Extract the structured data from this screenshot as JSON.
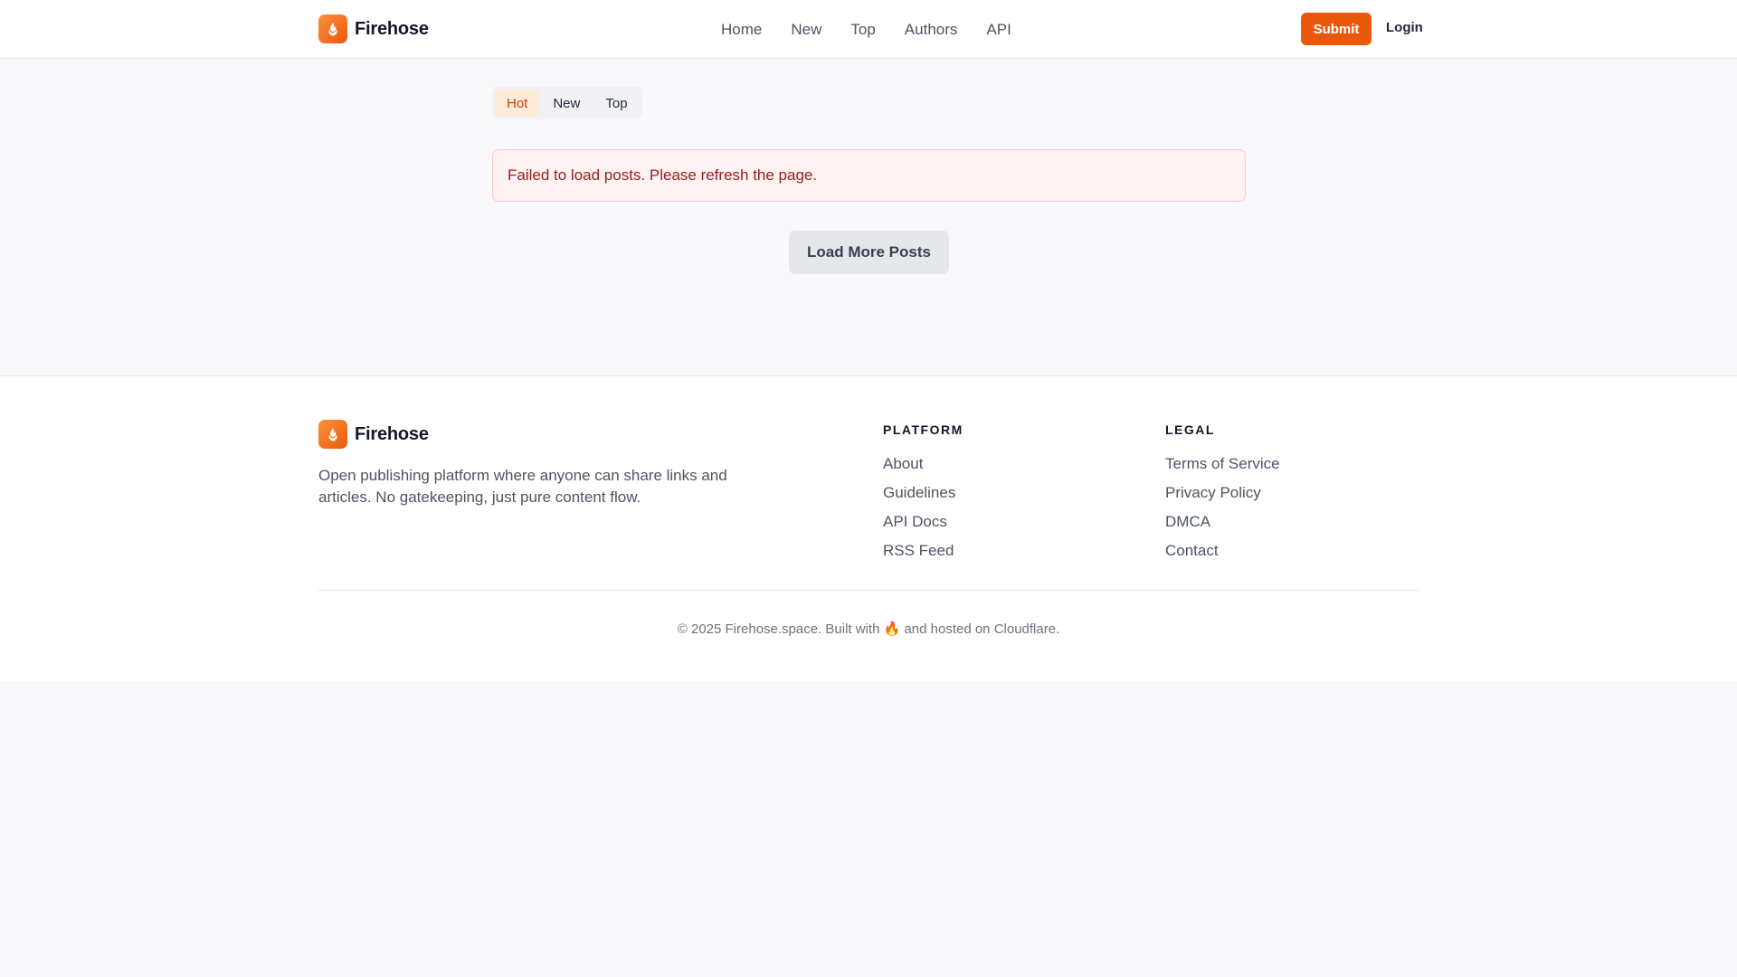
{
  "brand": {
    "name": "Firehose",
    "accent_color": "#ea580c",
    "logo_icon": "flame-icon"
  },
  "header": {
    "nav": [
      "Home",
      "New",
      "Top",
      "Authors",
      "API"
    ],
    "submit_label": "Submit",
    "login_label": "Login"
  },
  "main": {
    "tabs": [
      {
        "label": "Hot",
        "active": true
      },
      {
        "label": "New",
        "active": false
      },
      {
        "label": "Top",
        "active": false
      }
    ],
    "error_message": "Failed to load posts. Please refresh the page.",
    "load_more_label": "Load More Posts"
  },
  "footer": {
    "brand_name": "Firehose",
    "description": "Open publishing platform where anyone can share links and articles. No gatekeeping, just pure content flow.",
    "columns": [
      {
        "title": "PLATFORM",
        "links": [
          "About",
          "Guidelines",
          "API Docs",
          "RSS Feed"
        ]
      },
      {
        "title": "LEGAL",
        "links": [
          "Terms of Service",
          "Privacy Policy",
          "DMCA",
          "Contact"
        ]
      }
    ],
    "copyright": "© 2025 Firehose.space. Built with 🔥 and hosted on Cloudflare."
  }
}
